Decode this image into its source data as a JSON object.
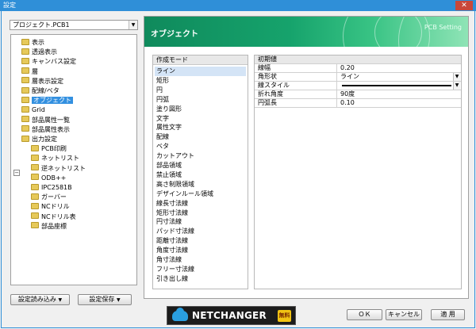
{
  "window": {
    "title": "設定",
    "close_label": "✕"
  },
  "project": {
    "selected": "プロジェクト.PCB1"
  },
  "tree": [
    {
      "label": "表示",
      "indent": 0
    },
    {
      "label": "透過表示",
      "indent": 0
    },
    {
      "label": "キャンバス設定",
      "indent": 0
    },
    {
      "label": "層",
      "indent": 0
    },
    {
      "label": "層表示設定",
      "indent": 0
    },
    {
      "label": "配線/ベタ",
      "indent": 0
    },
    {
      "label": "オブジェクト",
      "indent": 0,
      "selected": true
    },
    {
      "label": "Grid",
      "indent": 0
    },
    {
      "label": "部品属性一覧",
      "indent": 0
    },
    {
      "label": "部品属性表示",
      "indent": 0
    },
    {
      "label": "出力設定",
      "indent": 0,
      "expanded": true
    },
    {
      "label": "PCB印刷",
      "indent": 1
    },
    {
      "label": "ネットリスト",
      "indent": 1
    },
    {
      "label": "逆ネットリスト",
      "indent": 1
    },
    {
      "label": "ODB++",
      "indent": 1
    },
    {
      "label": "IPC2581B",
      "indent": 1
    },
    {
      "label": "ガーバー",
      "indent": 1
    },
    {
      "label": "NCドリル",
      "indent": 1
    },
    {
      "label": "NCドリル表",
      "indent": 1
    },
    {
      "label": "部品座標",
      "indent": 1
    }
  ],
  "buttons": {
    "load": "設定読み込み",
    "save": "設定保存",
    "ok": "ＯＫ",
    "cancel": "キャンセル",
    "apply": "適 用"
  },
  "banner": {
    "title": "オブジェクト",
    "subtitle": "PCB Setting"
  },
  "mode": {
    "header": "作成モード",
    "items": [
      "ライン",
      "矩形",
      "円",
      "円弧",
      "塗り図形",
      "文字",
      "属性文字",
      "配線",
      "ベタ",
      "カットアウト",
      "部品領域",
      "禁止領域",
      "高さ制限領域",
      "デザインルール領域",
      "線長寸法線",
      "矩形寸法線",
      "円寸法線",
      "パッド寸法線",
      "距離寸法線",
      "角度寸法線",
      "角寸法線",
      "フリー寸法線",
      "引き出し線"
    ],
    "selected_index": 0
  },
  "props": {
    "header": "初期値",
    "rows": [
      {
        "key": "線幅",
        "value": "0.20"
      },
      {
        "key": "角形状",
        "value": "ライン",
        "dropdown": true
      },
      {
        "key": "線スタイル",
        "value": "",
        "dropdown": true,
        "line_sample": true
      },
      {
        "key": "折れ角度",
        "value": "90度"
      },
      {
        "key": "円弧長",
        "value": "0.10"
      }
    ]
  },
  "logo": {
    "name": "NETCHANGER",
    "badge": "無料"
  },
  "colors": {
    "accent": "#2f8fd8",
    "banner": "#16a36c",
    "selection": "#3390e0"
  }
}
